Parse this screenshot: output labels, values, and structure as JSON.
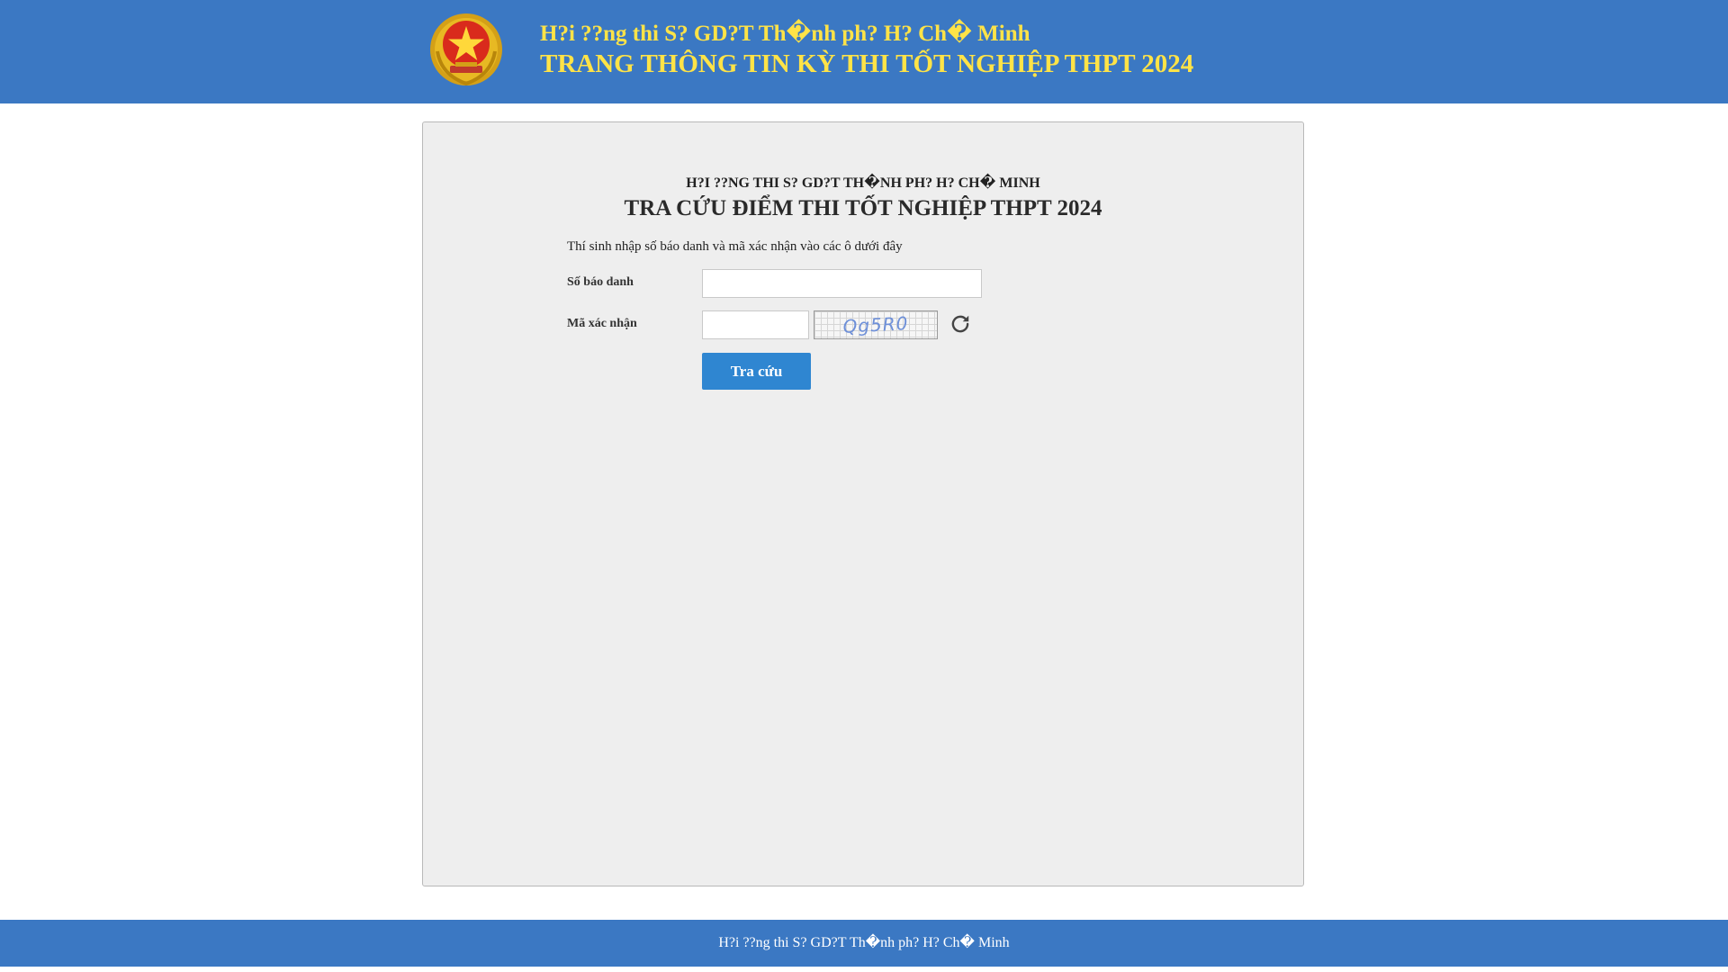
{
  "header": {
    "subtitle": "H?i ??ng thi S? GD?T Th�nh ph? H? Ch� Minh",
    "title": "TRANG THÔNG TIN KỲ THI TỐT NGHIỆP THPT 2024",
    "emblem_icon": "national-emblem-icon"
  },
  "form": {
    "council_name": "H?I ??NG THI S? GD?T TH�NH PH? H? CH� MINH",
    "title": "TRA CỨU ĐIỂM THI TỐT NGHIỆP THPT 2024",
    "instructions": "Thí sinh nhập số báo danh và mã xác nhận vào các ô dưới đây",
    "sbd_label": "Số báo danh",
    "sbd_value": "",
    "captcha_label": "Mã xác nhận",
    "captcha_value": "",
    "captcha_text": "Qg5R0",
    "refresh_icon": "refresh-icon",
    "submit_label": "Tra cứu"
  },
  "footer": {
    "text": "H?i ??ng thi S? GD?T Th�nh ph? H? Ch� Minh"
  },
  "colors": {
    "header_bg": "#3b78c3",
    "header_text": "#ffe347",
    "panel_bg": "#eeeeee",
    "button_bg": "#2f86d1"
  }
}
